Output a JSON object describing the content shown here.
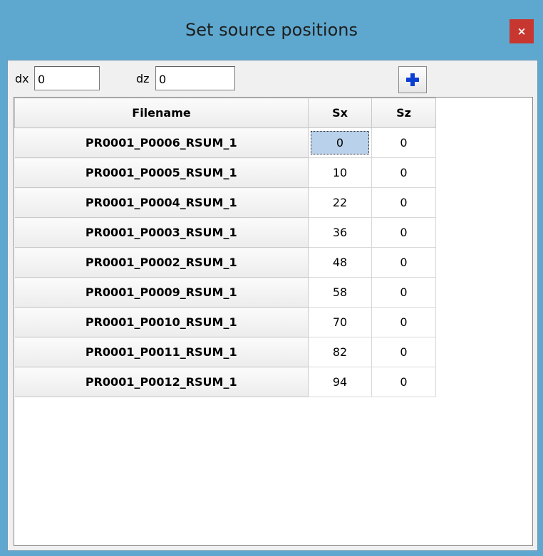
{
  "window": {
    "title": "Set source positions",
    "close_glyph": "×",
    "title_bar_color": "#5ea8cf",
    "close_color": "#c7372f"
  },
  "toolbar": {
    "dx_label": "dx",
    "dx_value": "0",
    "dz_label": "dz",
    "dz_value": "0",
    "add_icon": "plus-icon",
    "add_icon_color": "#0a3fd1"
  },
  "grid": {
    "columns": [
      "Filename",
      "Sx",
      "Sz"
    ],
    "rows": [
      {
        "filename": "PR0001_P0006_RSUM_1",
        "sx": "0",
        "sz": "0"
      },
      {
        "filename": "PR0001_P0005_RSUM_1",
        "sx": "10",
        "sz": "0"
      },
      {
        "filename": "PR0001_P0004_RSUM_1",
        "sx": "22",
        "sz": "0"
      },
      {
        "filename": "PR0001_P0003_RSUM_1",
        "sx": "36",
        "sz": "0"
      },
      {
        "filename": "PR0001_P0002_RSUM_1",
        "sx": "48",
        "sz": "0"
      },
      {
        "filename": "PR0001_P0009_RSUM_1",
        "sx": "58",
        "sz": "0"
      },
      {
        "filename": "PR0001_P0010_RSUM_1",
        "sx": "70",
        "sz": "0"
      },
      {
        "filename": "PR0001_P0011_RSUM_1",
        "sx": "82",
        "sz": "0"
      },
      {
        "filename": "PR0001_P0012_RSUM_1",
        "sx": "94",
        "sz": "0"
      }
    ],
    "selected_cell": {
      "row": 0,
      "column": "sx"
    }
  }
}
